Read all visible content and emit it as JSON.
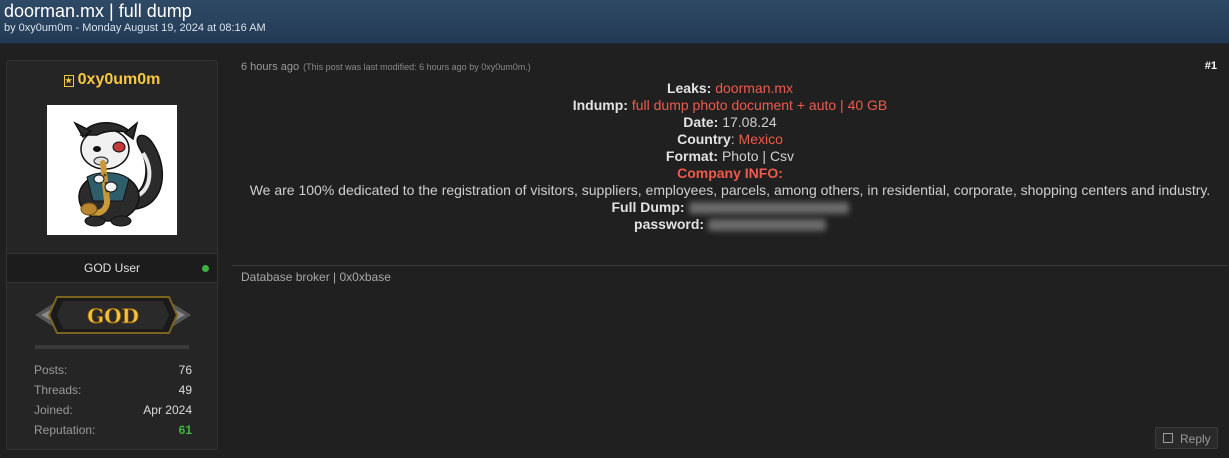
{
  "thread": {
    "title": "doorman.mx | full dump",
    "meta": "by 0xy0um0m - Monday August 19, 2024 at 08:16 AM"
  },
  "author": {
    "name": "0xy0um0m",
    "usertitle": "GOD User",
    "rank_label": "GOD",
    "stats": [
      {
        "label": "Posts:",
        "value": "76"
      },
      {
        "label": "Threads:",
        "value": "49"
      },
      {
        "label": "Joined:",
        "value": "Apr 2024"
      },
      {
        "label": "Reputation:",
        "value": "61"
      }
    ]
  },
  "post": {
    "date": "6 hours ago",
    "edited_note": "(This post was last modified: 6 hours ago by 0xy0um0m.)",
    "number": "#1",
    "lines": {
      "leaks_label": "Leaks:",
      "leaks_value": "doorman.mx",
      "indump_label": "Indump:",
      "indump_value": "full dump photo document + auto | 40 GB",
      "date_label": "Date:",
      "date_value": "17.08.24",
      "country_label": "Country",
      "country_sep": ":",
      "country_value": "Mexico",
      "format_label": "Format:",
      "format_value": "Photo | Csv",
      "company_label": "Company INFO:",
      "company_text": "We are 100% dedicated to the registration of visitors, suppliers, employees, parcels, among others, in residential, corporate, shopping centers and industry.",
      "fulldump_label": "Full Dump:",
      "password_label": "password:"
    },
    "signature": "Database broker | 0x0xbase",
    "reply_label": "Reply"
  },
  "colors": {
    "header_bg": "#2a4560",
    "accent_red": "#f05a4d",
    "username_gold": "#f6c842",
    "online_green": "#3db33d"
  }
}
